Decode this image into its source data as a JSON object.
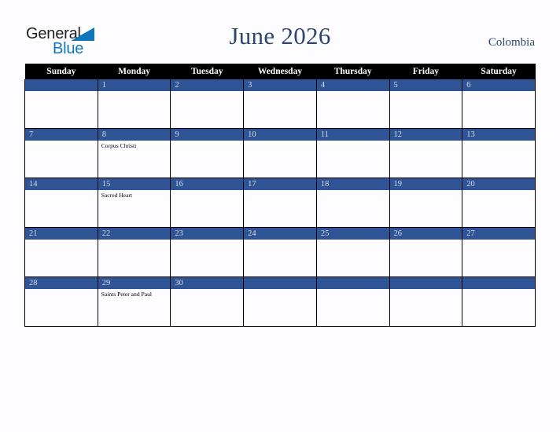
{
  "brand": {
    "name_part1": "General",
    "name_part2": "Blue",
    "triangle_icon": "triangle-icon",
    "color_dark": "#231f20",
    "color_blue": "#1076bc"
  },
  "header": {
    "title": "June 2026",
    "country": "Colombia",
    "title_color": "#2e456f"
  },
  "calendar": {
    "month": "June",
    "year": "2026",
    "weekday_headers": [
      "Sunday",
      "Monday",
      "Tuesday",
      "Wednesday",
      "Thursday",
      "Friday",
      "Saturday"
    ],
    "header_bg": "#000000",
    "daybar_bg": "#2f5496",
    "daybar_text_color": "#d6dce8",
    "weeks": [
      [
        {
          "day": "",
          "events": []
        },
        {
          "day": "1",
          "events": []
        },
        {
          "day": "2",
          "events": []
        },
        {
          "day": "3",
          "events": []
        },
        {
          "day": "4",
          "events": []
        },
        {
          "day": "5",
          "events": []
        },
        {
          "day": "6",
          "events": []
        }
      ],
      [
        {
          "day": "7",
          "events": []
        },
        {
          "day": "8",
          "events": [
            "Corpus Christi"
          ]
        },
        {
          "day": "9",
          "events": []
        },
        {
          "day": "10",
          "events": []
        },
        {
          "day": "11",
          "events": []
        },
        {
          "day": "12",
          "events": []
        },
        {
          "day": "13",
          "events": []
        }
      ],
      [
        {
          "day": "14",
          "events": []
        },
        {
          "day": "15",
          "events": [
            "Sacred Heart"
          ]
        },
        {
          "day": "16",
          "events": []
        },
        {
          "day": "17",
          "events": []
        },
        {
          "day": "18",
          "events": []
        },
        {
          "day": "19",
          "events": []
        },
        {
          "day": "20",
          "events": []
        }
      ],
      [
        {
          "day": "21",
          "events": []
        },
        {
          "day": "22",
          "events": []
        },
        {
          "day": "23",
          "events": []
        },
        {
          "day": "24",
          "events": []
        },
        {
          "day": "25",
          "events": []
        },
        {
          "day": "26",
          "events": []
        },
        {
          "day": "27",
          "events": []
        }
      ],
      [
        {
          "day": "28",
          "events": []
        },
        {
          "day": "29",
          "events": [
            "Saints Peter and Paul"
          ]
        },
        {
          "day": "30",
          "events": []
        },
        {
          "day": "",
          "events": []
        },
        {
          "day": "",
          "events": []
        },
        {
          "day": "",
          "events": []
        },
        {
          "day": "",
          "events": []
        }
      ]
    ]
  }
}
